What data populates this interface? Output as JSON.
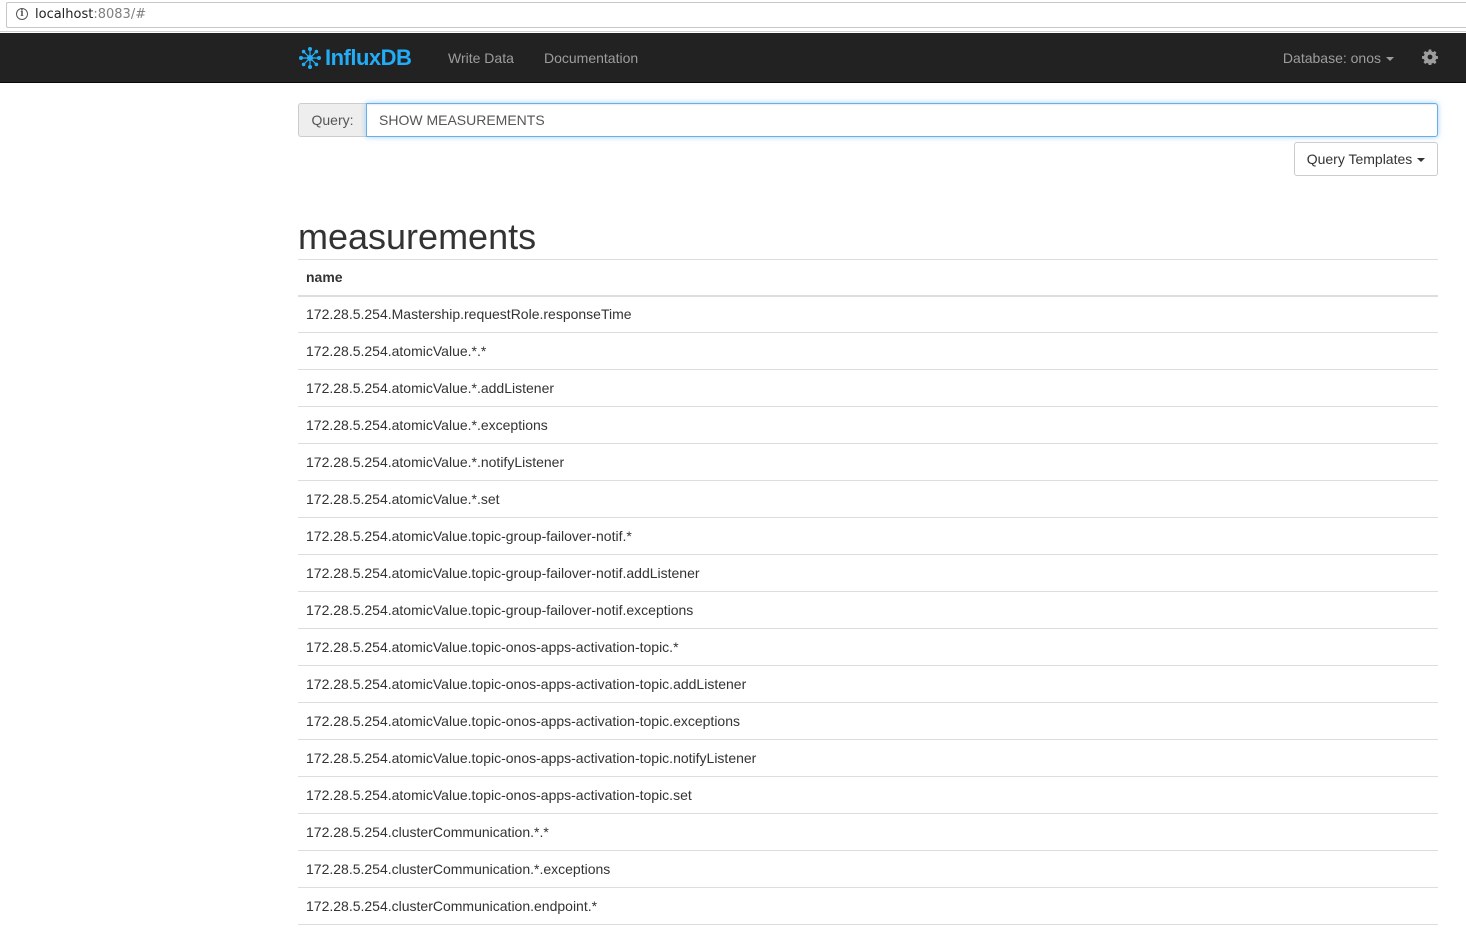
{
  "browser": {
    "url_host": "localhost",
    "url_rest": ":8083/#"
  },
  "navbar": {
    "brand": "InfluxDB",
    "brand_color": "#22adf6",
    "links": [
      "Write Data",
      "Documentation"
    ],
    "database_label": "Database: onos",
    "settings_icon": "gear-icon"
  },
  "query": {
    "label": "Query:",
    "value": "SHOW MEASUREMENTS",
    "templates_label": "Query Templates"
  },
  "results": {
    "title": "measurements",
    "columns": [
      "name"
    ],
    "rows": [
      "172.28.5.254.Mastership.requestRole.responseTime",
      "172.28.5.254.atomicValue.*.*",
      "172.28.5.254.atomicValue.*.addListener",
      "172.28.5.254.atomicValue.*.exceptions",
      "172.28.5.254.atomicValue.*.notifyListener",
      "172.28.5.254.atomicValue.*.set",
      "172.28.5.254.atomicValue.topic-group-failover-notif.*",
      "172.28.5.254.atomicValue.topic-group-failover-notif.addListener",
      "172.28.5.254.atomicValue.topic-group-failover-notif.exceptions",
      "172.28.5.254.atomicValue.topic-onos-apps-activation-topic.*",
      "172.28.5.254.atomicValue.topic-onos-apps-activation-topic.addListener",
      "172.28.5.254.atomicValue.topic-onos-apps-activation-topic.exceptions",
      "172.28.5.254.atomicValue.topic-onos-apps-activation-topic.notifyListener",
      "172.28.5.254.atomicValue.topic-onos-apps-activation-topic.set",
      "172.28.5.254.clusterCommunication.*.*",
      "172.28.5.254.clusterCommunication.*.exceptions",
      "172.28.5.254.clusterCommunication.endpoint.*"
    ]
  }
}
